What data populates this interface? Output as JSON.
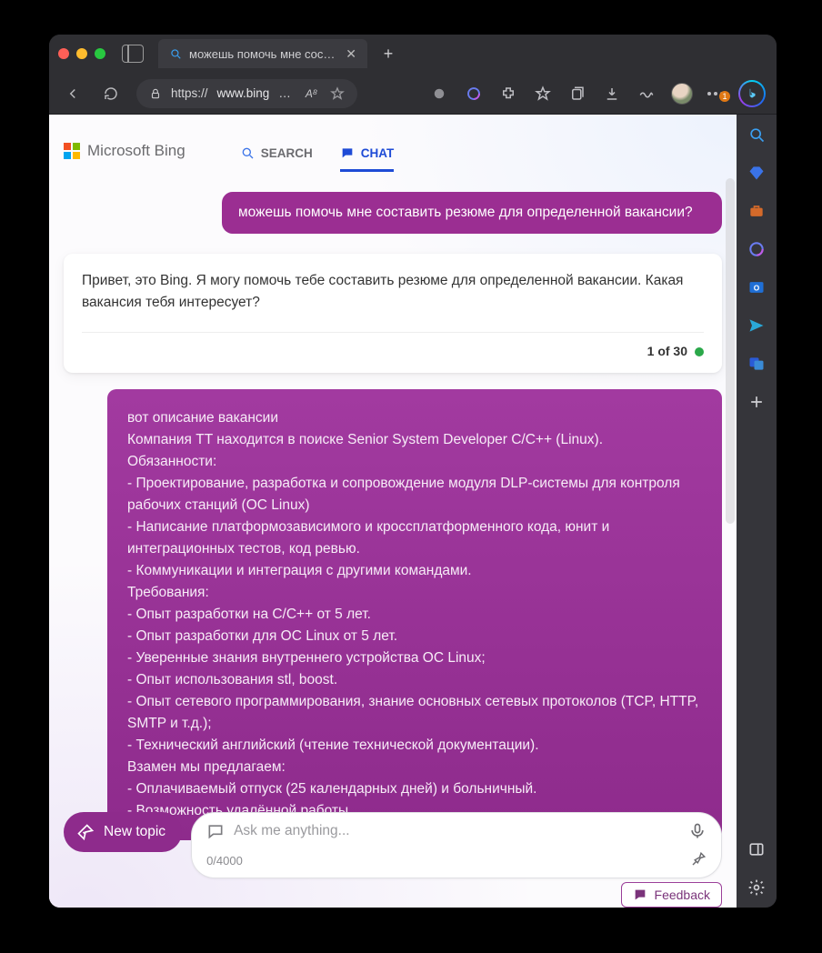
{
  "tab": {
    "title": "можешь помочь мне состави"
  },
  "toolbar": {
    "url_prefix": "https://",
    "url_host": "www.bing",
    "url_suffix": "…",
    "aa": "A⁸",
    "more_badge": "1"
  },
  "header": {
    "brand": "Microsoft Bing",
    "tab_search": "SEARCH",
    "tab_chat": "CHAT"
  },
  "chat": {
    "user1": "можешь помочь мне составить резюме для определенной вакансии?",
    "bot1": "Привет, это Bing. Я могу помочь тебе составить резюме для определенной вакансии. Какая вакансия тебя интересует?",
    "counter": "1 of 30",
    "user2": "вот описание вакансии\nКомпания TT находится в поиске Senior System Developer C/C++ (Linux).\nОбязанности:\n- Проектирование, разработка и сопровождение модуля DLP-системы для контроля рабочих станций (OC Linux)\n- Написание платформозависимого и кроссплатформенного кода, юнит и интеграционных тестов, код ревью.\n- Коммуникации и интеграция с другими командами.\nТребования:\n- Опыт разработки на C/C++ от 5 лет.\n- Опыт разработки для ОС Linux от 5 лет.\n- Уверенные знания внутреннего устройства ОС Linux;\n- Опыт использования stl, boost.\n- Опыт сетевого программирования, знание основных сетевых протоколов (TCP, HTTP, SMTP и т.д.);\n- Технический английский (чтение технической документации).\nВзамен мы предлагаем:\n- Оплачиваемый отпуск (25 календарных дней) и больничный.\n- Возможность удалённой работы."
  },
  "compose": {
    "new_topic": "New topic",
    "placeholder": "Ask me anything...",
    "counter": "0/4000",
    "feedback": "Feedback"
  }
}
